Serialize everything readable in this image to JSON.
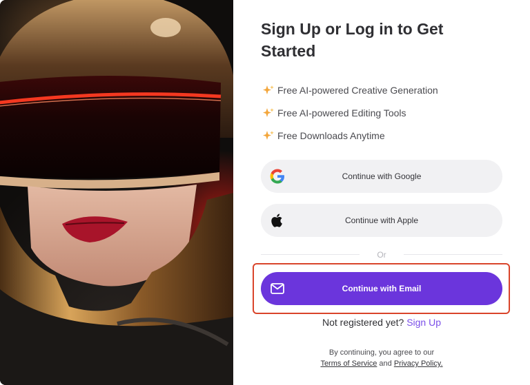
{
  "title": "Sign Up or Log in to Get Started",
  "features": [
    {
      "icon": "sparkle-icon",
      "label": "Free AI-powered Creative Generation"
    },
    {
      "icon": "sparkle-icon",
      "label": "Free AI-powered Editing Tools"
    },
    {
      "icon": "sparkle-icon",
      "label": "Free Downloads Anytime"
    }
  ],
  "buttons": {
    "google": "Continue with Google",
    "apple": "Continue with Apple",
    "email": "Continue with Email"
  },
  "divider_text": "Or",
  "register": {
    "prompt": "Not registered yet?",
    "link": "Sign Up"
  },
  "legal": {
    "prefix": "By continuing, you agree to our",
    "terms": "Terms of Service",
    "and": "and",
    "privacy": "Privacy Policy."
  },
  "colors": {
    "accent": "#6b35dc",
    "link": "#7a4ee8",
    "highlight_border": "#d9442a"
  }
}
